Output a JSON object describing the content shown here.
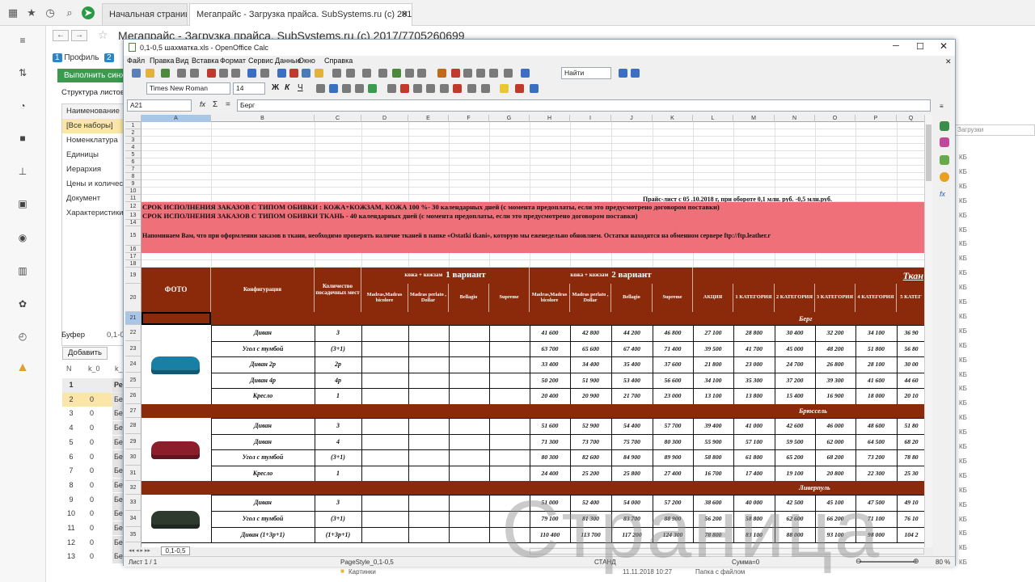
{
  "browser": {
    "tabs": [
      {
        "label": "Начальная страница"
      },
      {
        "label": "Мегапрайс - Загрузка прайса. SubSystems.ru (c) 2017/7705260699"
      }
    ],
    "close_label": "✕"
  },
  "onec": {
    "title": "Мегапрайс - Загрузка прайса. SubSystems.ru (c) 2017/7705260699",
    "tab_profile_num": "1",
    "tab_profile": "Профиль",
    "tab2_num": "2",
    "green_button": "Выполнить синхро",
    "struct_title": "Структура листов",
    "struct_items": [
      "Наименование",
      "[Все наборы]",
      "Номенклатура",
      "Единицы",
      "Иерархия",
      "Цены и количество",
      "Документ",
      "Характеристики"
    ],
    "buffer_tab": "Буфер",
    "buffer_tab2": "0,1-0",
    "add_button": "Добавить",
    "buffer_cols": [
      "N",
      "k_0",
      "k_"
    ],
    "buffer_rows": [
      {
        "n": "1",
        "k0": "",
        "k": "Ре"
      },
      {
        "n": "2",
        "k0": "0",
        "k": "Бе"
      },
      {
        "n": "3",
        "k0": "0",
        "k": "Бе"
      },
      {
        "n": "4",
        "k0": "0",
        "k": "Бе"
      },
      {
        "n": "5",
        "k0": "0",
        "k": "Бе"
      },
      {
        "n": "6",
        "k0": "0",
        "k": "Бе"
      },
      {
        "n": "7",
        "k0": "0",
        "k": "Бе"
      },
      {
        "n": "8",
        "k0": "0",
        "k": "Бе"
      },
      {
        "n": "9",
        "k0": "0",
        "k": "Бе"
      },
      {
        "n": "10",
        "k0": "0",
        "k": "Бе"
      },
      {
        "n": "11",
        "k0": "0",
        "k": "Бе"
      },
      {
        "n": "12",
        "k0": "0",
        "k": "Бе"
      },
      {
        "n": "13",
        "k0": "0",
        "k": "Бе"
      }
    ]
  },
  "explorer": {
    "search_placeholder": "Загрузки",
    "size_label": "КБ",
    "rows_bottom": [
      {
        "name": "Картинки",
        "date": "11.11.2018 10:27",
        "type": "Папка с файлом"
      }
    ]
  },
  "calc": {
    "title": "0,1-0,5 шахматка.xls - OpenOffice Calc",
    "menu": [
      "Файл",
      "Правка",
      "Вид",
      "Вставка",
      "Формат",
      "Сервис",
      "Данные",
      "Окно",
      "Справка"
    ],
    "find_placeholder": "Найти",
    "font_name": "Times New Roman",
    "font_size": "14",
    "cell_ref": "A21",
    "formula_value": "Берг",
    "columns": [
      "A",
      "B",
      "C",
      "D",
      "E",
      "F",
      "G",
      "H",
      "I",
      "J",
      "K",
      "L",
      "M",
      "N",
      "O",
      "P",
      "Q"
    ],
    "price_header": "Прайс-лист с 05 .10.2018 г,   при обороте   0,1  млн. руб. -0,5  млн.руб.",
    "banner12": "СРОК ИСПОЛНЕНИЯ  ЗАКАЗОВ С ТИПОМ ОБИВКИ : КОЖА+КОЖЗАМ, КОЖА 100 %- 30 календарных дней (с момента предоплаты, если это предусмотрено договором поставки)",
    "banner13": "СРОК ИСПОЛНЕНИЯ  ЗАКАЗОВ С ТИПОМ ОБИВКИ ТКАНЬ - 40 календарных дней (с момента предоплаты, если это предусмотрено договором поставки)",
    "banner15": "Напоминаем Вам, что при оформлении заказов в ткани, необходимо проверять наличие тканей в папке «Ostatki tkani», которую мы еженедельно обновляем. Остатки находятся на обменном сервере ftp://ftp.leather.r",
    "header": {
      "photo": "ФОТО",
      "config": "Конфигурация",
      "qty": "Количество посадочных мест",
      "var1_small": "кожа + кожзам",
      "var1_big": "1 вариант",
      "var2_small": "кожа + кожзам",
      "var2_big": "2 вариант",
      "fabric": "Ткан",
      "madras1": "Madras,Madras bicolore",
      "madras2": "Madras perlato , Dollar",
      "bellagio": "Bellagio",
      "supreme": "Supreme",
      "akcia": "АКЦИЯ",
      "cats": [
        "1 КАТЕГОРИЯ",
        "2 КАТЕГОРИЯ",
        "3 КАТЕГОРИЯ",
        "4 КАТЕГОРИЯ",
        "5 КАТЕГ"
      ]
    },
    "groups": [
      {
        "name": "Берг",
        "row": "21",
        "items": [
          {
            "row": "22",
            "config": "Диван",
            "qty": "3",
            "prices": [
              "41 600",
              "42 800",
              "44 200",
              "46 800",
              "27 100",
              "28 800",
              "30 400",
              "32 200",
              "34 100",
              "36 90"
            ]
          },
          {
            "row": "23",
            "config": "Угол с тумбой",
            "qty": "(3+1)",
            "prices": [
              "63 700",
              "65 600",
              "67 400",
              "71 400",
              "39 500",
              "41 700",
              "45 000",
              "48 200",
              "51 800",
              "56 80"
            ]
          },
          {
            "row": "24",
            "config": "Диван 2р",
            "qty": "2р",
            "prices": [
              "33 400",
              "34 400",
              "35 400",
              "37 600",
              "21 800",
              "23 000",
              "24 700",
              "26 800",
              "28 100",
              "30 00"
            ]
          },
          {
            "row": "25",
            "config": "Диван 4р",
            "qty": "4р",
            "prices": [
              "50 200",
              "51 900",
              "53 400",
              "56 600",
              "34 100",
              "35 300",
              "37 200",
              "39 300",
              "41 600",
              "44 60"
            ]
          },
          {
            "row": "26",
            "config": "Кресло",
            "qty": "1",
            "prices": [
              "20 400",
              "20 900",
              "21 700",
              "23 000",
              "13 100",
              "13 800",
              "15 400",
              "16 900",
              "18 000",
              "20 10"
            ]
          }
        ]
      },
      {
        "name": "Брюссель",
        "row": "27",
        "items": [
          {
            "row": "28",
            "config": "Диван",
            "qty": "3",
            "prices": [
              "51 600",
              "52 900",
              "54 400",
              "57 700",
              "39 400",
              "41 000",
              "42 600",
              "46 000",
              "48 600",
              "51 80"
            ]
          },
          {
            "row": "29",
            "config": "Диван",
            "qty": "4",
            "prices": [
              "71 300",
              "73 700",
              "75 700",
              "80 300",
              "55 900",
              "57 100",
              "59 500",
              "62 000",
              "64 500",
              "68 20"
            ]
          },
          {
            "row": "30",
            "config": "Угол с тумбой",
            "qty": "(3+1)",
            "prices": [
              "80 300",
              "82 600",
              "84 900",
              "89 900",
              "58 800",
              "61 800",
              "65 200",
              "68 200",
              "73 200",
              "78 80"
            ]
          },
          {
            "row": "31",
            "config": "Кресло",
            "qty": "1",
            "prices": [
              "24 400",
              "25 200",
              "25 800",
              "27 400",
              "16 700",
              "17 400",
              "19 100",
              "20 800",
              "22 300",
              "25 30"
            ]
          }
        ]
      },
      {
        "name": "Ливерпуль",
        "row": "32",
        "items": [
          {
            "row": "33",
            "config": "Диван",
            "qty": "3",
            "prices": [
              "51 000",
              "52 400",
              "54 000",
              "57 200",
              "38 600",
              "40 000",
              "42 500",
              "45 100",
              "47 500",
              "49 10"
            ]
          },
          {
            "row": "34",
            "config": "Угол с тумбой",
            "qty": "(3+1)",
            "prices": [
              "79 100",
              "81 300",
              "83 700",
              "88 900",
              "56 200",
              "58 800",
              "62 600",
              "66 200",
              "71 100",
              "76 10"
            ]
          },
          {
            "row": "35",
            "config": "Диван (1+3р+1)",
            "qty": "(1+3р+1)",
            "prices": [
              "110 400",
              "113 700",
              "117 200",
              "124 300",
              "78 800",
              "83 100",
              "88 000",
              "93 100",
              "98 000",
              "104 2"
            ]
          }
        ]
      }
    ],
    "sheet_tab": "0,1-0,5",
    "status": {
      "sheet": "Лист 1 / 1",
      "page_style": "PageStyle_0,1-0,5",
      "mode": "СТАНД",
      "sum": "Сумма=0",
      "zoom": "80 %"
    }
  },
  "watermark": "Страница",
  "colors": {
    "accent_red": "#f0707a",
    "header_brown": "#8b2a0a",
    "green": "#3a9a4d"
  }
}
